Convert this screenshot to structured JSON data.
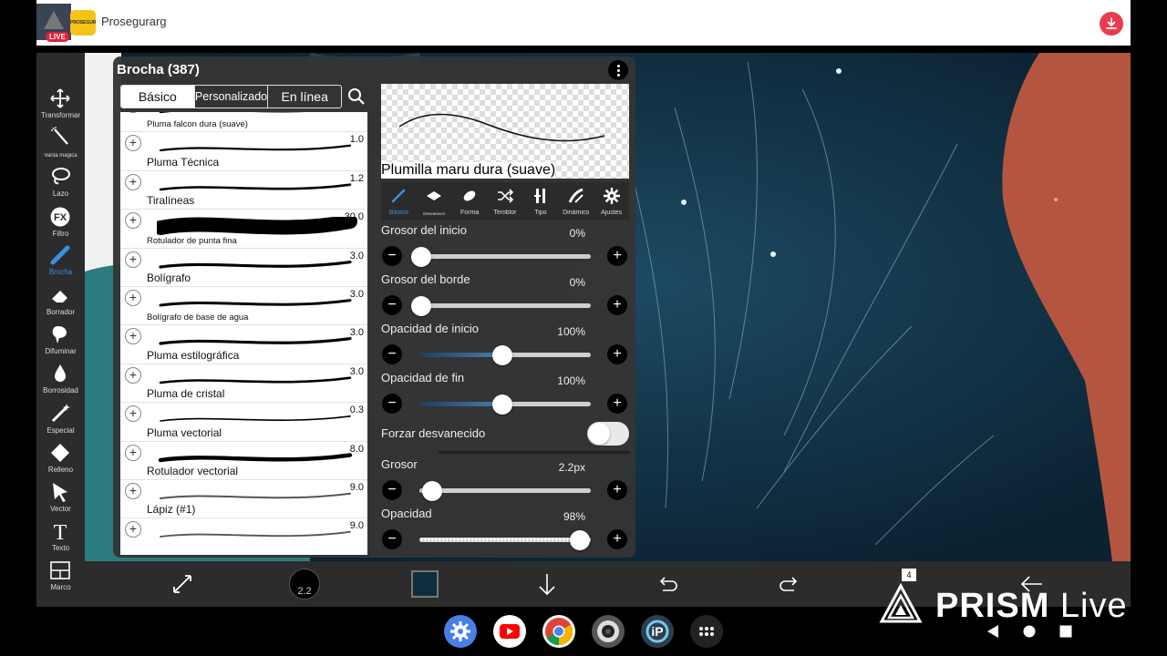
{
  "stream": {
    "live_badge": "LIVE",
    "logo_text": "PROSEGUR",
    "brand_name": "Prosegurarg"
  },
  "panel": {
    "title": "Brocha (387)",
    "tabs": [
      "Básico",
      "Personalizado",
      "En línea"
    ],
    "brushes": [
      {
        "name": "Pluma falcon dura (suave)",
        "size": ""
      },
      {
        "name": "Pluma Técnica",
        "size": "1.0"
      },
      {
        "name": "Tiralíneas",
        "size": "1.2"
      },
      {
        "name": "Rotulador de punta fina",
        "size": "30.0"
      },
      {
        "name": "Bolígrafo",
        "size": "3.0"
      },
      {
        "name": "Bolígrafo de base de agua",
        "size": "3.0"
      },
      {
        "name": "Pluma estilográfica",
        "size": "3.0"
      },
      {
        "name": "Pluma de cristal",
        "size": "3.0"
      },
      {
        "name": "Pluma vectorial",
        "size": "0.3"
      },
      {
        "name": "Rotulador vectorial",
        "size": "8.0"
      },
      {
        "name": "Lápiz (#1)",
        "size": "9.0"
      },
      {
        "name": "",
        "size": "9.0"
      }
    ],
    "preview_name": "Plumilla maru dura (suave)",
    "icon_tabs": [
      "Básico",
      "Desvanecer",
      "Forma",
      "Temblor",
      "Tipo",
      "Dinámico",
      "Ajustes"
    ],
    "settings": [
      {
        "name": "Grosor del inicio",
        "value": "0%",
        "level": 0.0
      },
      {
        "name": "Grosor del borde",
        "value": "0%",
        "level": 0.0
      },
      {
        "name": "Opacidad de inicio",
        "value": "100%",
        "level": 0.5
      },
      {
        "name": "Opacidad de fin",
        "value": "100%",
        "level": 0.5
      }
    ],
    "force_fade": {
      "label": "Forzar desvanecido",
      "on": false
    },
    "thickness": {
      "name": "Grosor",
      "value": "2.2px",
      "level": 0.07
    },
    "opacity": {
      "name": "Opacidad",
      "value": "98%",
      "level": 0.98
    }
  },
  "toolbar": [
    "Transformar",
    "Varita mágica",
    "Lazo",
    "Filtro",
    "Brocha",
    "Borrador",
    "Difuminar",
    "Borrosidad",
    "Especial",
    "Relleno",
    "Vector",
    "Texto",
    "Marco"
  ],
  "bottom": {
    "brush_size": "2.2",
    "layer_count": "4",
    "color": "#0e2d3d"
  },
  "overlay": {
    "prism_bold": "PRISM",
    "prism_light": "Live"
  },
  "colors": {
    "accent": "#3d8fe0",
    "canvas": "#0f2b3d",
    "skin": "#b4563f",
    "teal": "#2a7c7f"
  }
}
